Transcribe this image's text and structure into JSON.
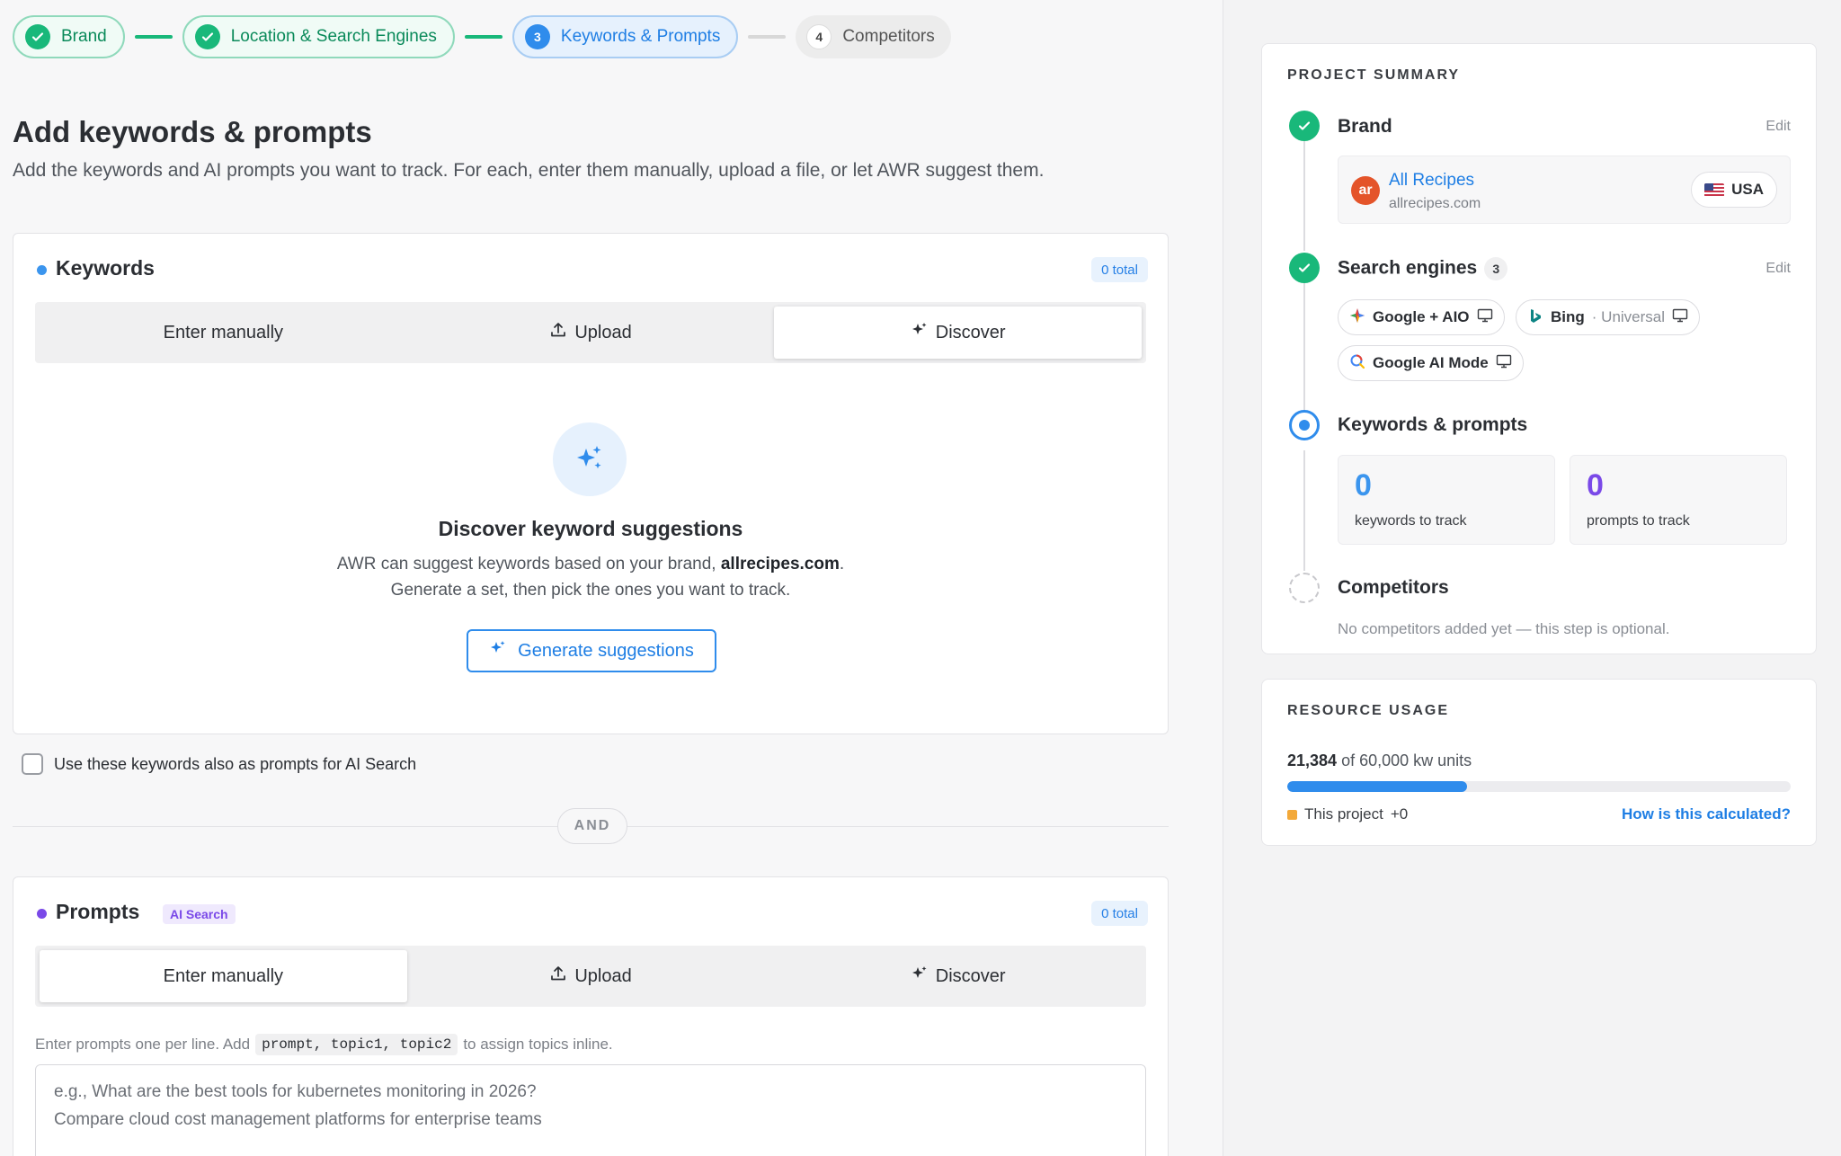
{
  "stepper": {
    "steps": [
      {
        "num": "",
        "label": "Brand",
        "state": "done"
      },
      {
        "num": "",
        "label": "Location & Search Engines",
        "state": "done"
      },
      {
        "num": "3",
        "label": "Keywords & Prompts",
        "state": "active"
      },
      {
        "num": "4",
        "label": "Competitors",
        "state": "todo"
      }
    ]
  },
  "page": {
    "title": "Add keywords & prompts",
    "subtitle": "Add the keywords and AI prompts you want to track. For each, enter them manually, upload a file, or let AWR suggest them."
  },
  "keywords": {
    "title": "Keywords",
    "total": "0 total",
    "tabs": {
      "manual": "Enter manually",
      "upload": "Upload",
      "discover": "Discover"
    },
    "selected_tab": "Discover",
    "empty_title": "Discover keyword suggestions",
    "empty_line1_prefix": "AWR can suggest keywords based on your brand, ",
    "empty_line1_brand": "allrecipes.com",
    "empty_line1_suffix": ".",
    "empty_line2": "Generate a set, then pick the ones you want to track.",
    "generate_button": "Generate suggestions",
    "also_prompts_label": "Use these keywords also as prompts for AI Search",
    "also_prompts_checked": false
  },
  "divider": {
    "label": "AND"
  },
  "prompts": {
    "title": "Prompts",
    "badge": "AI Search",
    "total": "0 total",
    "tabs": {
      "manual": "Enter manually",
      "upload": "Upload",
      "discover": "Discover"
    },
    "selected_tab": "Enter manually",
    "hint_prefix": "Enter prompts one per line. Add",
    "hint_code": "prompt, topic1, topic2",
    "hint_suffix": "to assign topics inline.",
    "placeholder_line1": "e.g., What are the best tools for kubernetes monitoring in 2026?",
    "placeholder_line2": "Compare cloud cost management platforms for enterprise teams"
  },
  "summary": {
    "heading": "PROJECT SUMMARY",
    "edit_label": "Edit",
    "brand": {
      "title": "Brand",
      "name": "All Recipes",
      "domain": "allrecipes.com",
      "logo_text": "ar",
      "country": "USA"
    },
    "engines": {
      "title": "Search engines",
      "count": "3",
      "items": [
        {
          "name": "Google + AIO",
          "icon": "google-icon",
          "device": "desktop-icon"
        },
        {
          "name": "Bing",
          "extra": "· Universal",
          "icon": "bing-icon",
          "device": "desktop-icon"
        },
        {
          "name": "Google AI Mode",
          "icon": "google-ai-mode-icon",
          "device": "desktop-icon"
        }
      ]
    },
    "kp": {
      "title": "Keywords & prompts",
      "keywords_count": "0",
      "keywords_label": "keywords to track",
      "prompts_count": "0",
      "prompts_label": "prompts to track"
    },
    "competitors": {
      "title": "Competitors",
      "text": "No competitors added yet — this step is optional."
    }
  },
  "resource": {
    "heading": "RESOURCE USAGE",
    "used": "21,384",
    "of_text": "of 60,000 kw units",
    "used_fraction": 0.3564,
    "legend": "This project",
    "legend_delta": "+0",
    "link": "How is this calculated?"
  },
  "colors": {
    "accent": "#2f8cec",
    "success": "#19b87a",
    "prompt_purple": "#7a49e8",
    "keyword_blue": "#3b95ee",
    "project_orange": "#f3a93a"
  }
}
